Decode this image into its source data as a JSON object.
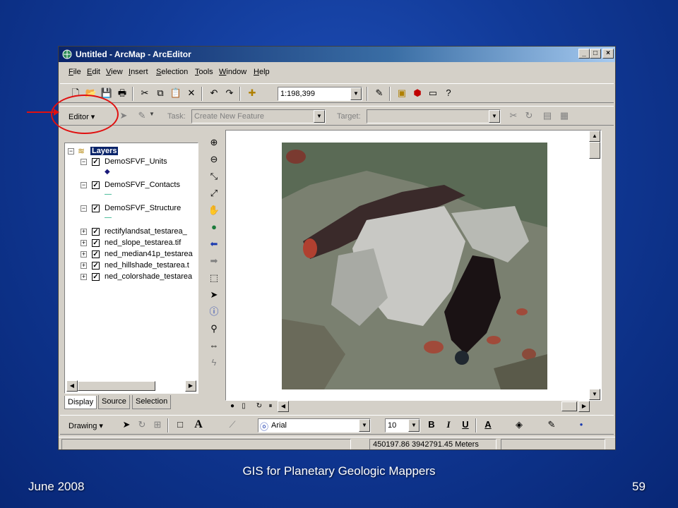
{
  "window": {
    "title": "Untitled - ArcMap - ArcEditor",
    "controls": {
      "minimize": "_",
      "maximize": "□",
      "close": "×"
    }
  },
  "menu": [
    "File",
    "Edit",
    "View",
    "Insert",
    "Selection",
    "Tools",
    "Window",
    "Help"
  ],
  "standard_toolbar": {
    "scale_value": "1:198,399"
  },
  "editor_toolbar": {
    "editor_label": "Editor ▾",
    "task_label": "Task:",
    "task_value": "Create New Feature",
    "target_label": "Target:",
    "target_value": ""
  },
  "toc": {
    "root_label": "Layers",
    "layers": [
      {
        "name": "DemoSFVF_Units",
        "checked": true,
        "expanded": true,
        "symbol": "◆"
      },
      {
        "name": "DemoSFVF_Contacts",
        "checked": true,
        "expanded": true,
        "symbol": "—"
      },
      {
        "name": "DemoSFVF_Structure",
        "checked": true,
        "expanded": true,
        "symbol": "—"
      },
      {
        "name": "rectifylandsat_testarea_",
        "checked": true,
        "expanded": false
      },
      {
        "name": "ned_slope_testarea.tif",
        "checked": true,
        "expanded": false
      },
      {
        "name": "ned_median41p_testarea",
        "checked": true,
        "expanded": false
      },
      {
        "name": "ned_hillshade_testarea.t",
        "checked": true,
        "expanded": false
      },
      {
        "name": "ned_colorshade_testarea",
        "checked": true,
        "expanded": false
      }
    ],
    "tabs": [
      "Display",
      "Source",
      "Selection"
    ]
  },
  "drawing_toolbar": {
    "drawing_label": "Drawing ▾",
    "font_value": "Arial",
    "font_size_value": "10",
    "bold": "B",
    "italic": "I",
    "underline": "U",
    "text_tool": "A"
  },
  "status": {
    "coordinates": "450197.86  3942791.45 Meters"
  },
  "slide_footer": {
    "date": "June 2008",
    "title": "GIS for Planetary Geologic Mappers",
    "page": "59"
  },
  "colors": {
    "title_bar": "#0a246a",
    "annotation": "#e01010",
    "slide_bg": "#113a98"
  }
}
